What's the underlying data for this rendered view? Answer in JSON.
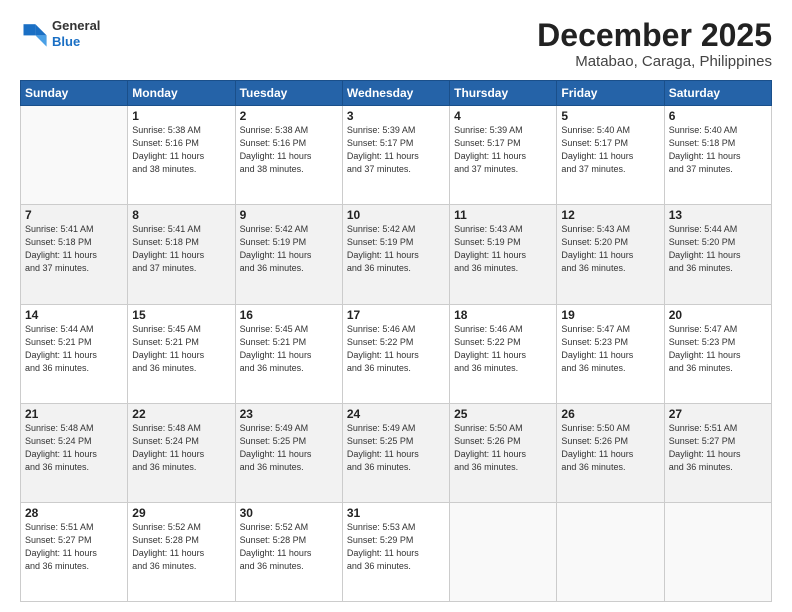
{
  "header": {
    "logo_line1": "General",
    "logo_line2": "Blue",
    "main_title": "December 2025",
    "subtitle": "Matabao, Caraga, Philippines"
  },
  "weekdays": [
    "Sunday",
    "Monday",
    "Tuesday",
    "Wednesday",
    "Thursday",
    "Friday",
    "Saturday"
  ],
  "weeks": [
    [
      {
        "num": "",
        "info": ""
      },
      {
        "num": "1",
        "info": "Sunrise: 5:38 AM\nSunset: 5:16 PM\nDaylight: 11 hours\nand 38 minutes."
      },
      {
        "num": "2",
        "info": "Sunrise: 5:38 AM\nSunset: 5:16 PM\nDaylight: 11 hours\nand 38 minutes."
      },
      {
        "num": "3",
        "info": "Sunrise: 5:39 AM\nSunset: 5:17 PM\nDaylight: 11 hours\nand 37 minutes."
      },
      {
        "num": "4",
        "info": "Sunrise: 5:39 AM\nSunset: 5:17 PM\nDaylight: 11 hours\nand 37 minutes."
      },
      {
        "num": "5",
        "info": "Sunrise: 5:40 AM\nSunset: 5:17 PM\nDaylight: 11 hours\nand 37 minutes."
      },
      {
        "num": "6",
        "info": "Sunrise: 5:40 AM\nSunset: 5:18 PM\nDaylight: 11 hours\nand 37 minutes."
      }
    ],
    [
      {
        "num": "7",
        "info": "Sunrise: 5:41 AM\nSunset: 5:18 PM\nDaylight: 11 hours\nand 37 minutes."
      },
      {
        "num": "8",
        "info": "Sunrise: 5:41 AM\nSunset: 5:18 PM\nDaylight: 11 hours\nand 37 minutes."
      },
      {
        "num": "9",
        "info": "Sunrise: 5:42 AM\nSunset: 5:19 PM\nDaylight: 11 hours\nand 36 minutes."
      },
      {
        "num": "10",
        "info": "Sunrise: 5:42 AM\nSunset: 5:19 PM\nDaylight: 11 hours\nand 36 minutes."
      },
      {
        "num": "11",
        "info": "Sunrise: 5:43 AM\nSunset: 5:19 PM\nDaylight: 11 hours\nand 36 minutes."
      },
      {
        "num": "12",
        "info": "Sunrise: 5:43 AM\nSunset: 5:20 PM\nDaylight: 11 hours\nand 36 minutes."
      },
      {
        "num": "13",
        "info": "Sunrise: 5:44 AM\nSunset: 5:20 PM\nDaylight: 11 hours\nand 36 minutes."
      }
    ],
    [
      {
        "num": "14",
        "info": "Sunrise: 5:44 AM\nSunset: 5:21 PM\nDaylight: 11 hours\nand 36 minutes."
      },
      {
        "num": "15",
        "info": "Sunrise: 5:45 AM\nSunset: 5:21 PM\nDaylight: 11 hours\nand 36 minutes."
      },
      {
        "num": "16",
        "info": "Sunrise: 5:45 AM\nSunset: 5:21 PM\nDaylight: 11 hours\nand 36 minutes."
      },
      {
        "num": "17",
        "info": "Sunrise: 5:46 AM\nSunset: 5:22 PM\nDaylight: 11 hours\nand 36 minutes."
      },
      {
        "num": "18",
        "info": "Sunrise: 5:46 AM\nSunset: 5:22 PM\nDaylight: 11 hours\nand 36 minutes."
      },
      {
        "num": "19",
        "info": "Sunrise: 5:47 AM\nSunset: 5:23 PM\nDaylight: 11 hours\nand 36 minutes."
      },
      {
        "num": "20",
        "info": "Sunrise: 5:47 AM\nSunset: 5:23 PM\nDaylight: 11 hours\nand 36 minutes."
      }
    ],
    [
      {
        "num": "21",
        "info": "Sunrise: 5:48 AM\nSunset: 5:24 PM\nDaylight: 11 hours\nand 36 minutes."
      },
      {
        "num": "22",
        "info": "Sunrise: 5:48 AM\nSunset: 5:24 PM\nDaylight: 11 hours\nand 36 minutes."
      },
      {
        "num": "23",
        "info": "Sunrise: 5:49 AM\nSunset: 5:25 PM\nDaylight: 11 hours\nand 36 minutes."
      },
      {
        "num": "24",
        "info": "Sunrise: 5:49 AM\nSunset: 5:25 PM\nDaylight: 11 hours\nand 36 minutes."
      },
      {
        "num": "25",
        "info": "Sunrise: 5:50 AM\nSunset: 5:26 PM\nDaylight: 11 hours\nand 36 minutes."
      },
      {
        "num": "26",
        "info": "Sunrise: 5:50 AM\nSunset: 5:26 PM\nDaylight: 11 hours\nand 36 minutes."
      },
      {
        "num": "27",
        "info": "Sunrise: 5:51 AM\nSunset: 5:27 PM\nDaylight: 11 hours\nand 36 minutes."
      }
    ],
    [
      {
        "num": "28",
        "info": "Sunrise: 5:51 AM\nSunset: 5:27 PM\nDaylight: 11 hours\nand 36 minutes."
      },
      {
        "num": "29",
        "info": "Sunrise: 5:52 AM\nSunset: 5:28 PM\nDaylight: 11 hours\nand 36 minutes."
      },
      {
        "num": "30",
        "info": "Sunrise: 5:52 AM\nSunset: 5:28 PM\nDaylight: 11 hours\nand 36 minutes."
      },
      {
        "num": "31",
        "info": "Sunrise: 5:53 AM\nSunset: 5:29 PM\nDaylight: 11 hours\nand 36 minutes."
      },
      {
        "num": "",
        "info": ""
      },
      {
        "num": "",
        "info": ""
      },
      {
        "num": "",
        "info": ""
      }
    ]
  ]
}
